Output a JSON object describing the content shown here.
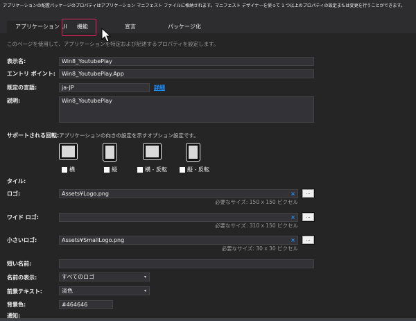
{
  "header": {
    "description": "アプリケーションの配置パッケージのプロパティはアプリケーション マニフェスト ファイルに格納されます。マニフェスト デザイナーを使って 1 つ以上のプロパティの設定または変更を行うことができます。"
  },
  "tabs": [
    {
      "label": "アプリケーション UI"
    },
    {
      "label": "機能"
    },
    {
      "label": "宣言"
    },
    {
      "label": "パッケージ化"
    }
  ],
  "page": {
    "subtitle": "このページを使用して、アプリケーションを特定および記述するプロパティを設定します。"
  },
  "fields": {
    "display_name": {
      "label": "表示名:",
      "value": "Win8_YoutubePlay"
    },
    "entry_point": {
      "label": "エントリ ポイント:",
      "value": "Win8_YoutubePlay.App"
    },
    "default_language": {
      "label": "既定の言語:",
      "value": "ja-JP",
      "link": "詳細"
    },
    "description": {
      "label": "説明:",
      "value": "Win8_YoutubePlay"
    }
  },
  "rotation": {
    "label": "サポートされる回転:",
    "hint": "アプリケーションの向きの設定を示すオプション設定です。",
    "options": [
      {
        "label": "横",
        "checked": false
      },
      {
        "label": "縦",
        "checked": false
      },
      {
        "label": "横 - 反転",
        "checked": false
      },
      {
        "label": "縦 - 反転",
        "checked": false
      }
    ]
  },
  "tile": {
    "heading": "タイル:",
    "logo": {
      "label": "ロゴ:",
      "value": "Assets¥Logo.png",
      "hint": "必要なサイズ: 150 x 150 ピクセル"
    },
    "wide_logo": {
      "label": "ワイド ロゴ:",
      "value": "",
      "hint": "必要なサイズ: 310 x 150 ピクセル"
    },
    "small_logo": {
      "label": "小さいロゴ:",
      "value": "Assets¥SmallLogo.png",
      "hint": "必要なサイズ: 30 x 30 ピクセル"
    },
    "short_name": {
      "label": "短い名前:",
      "value": ""
    },
    "show_name": {
      "label": "名前の表示:",
      "value": "すべてのロゴ"
    },
    "foreground_text": {
      "label": "前景テキスト:",
      "value": "淡色"
    },
    "background_color": {
      "label": "背景色:",
      "value": "#464646"
    },
    "clear_glyph": "×",
    "browse_label": "...",
    "dropdown_glyph": "▾"
  },
  "partial_section": {
    "label": "通知:"
  },
  "colors": {
    "highlight": "#e0245e",
    "link": "#1e90ff",
    "background": "#252526"
  }
}
